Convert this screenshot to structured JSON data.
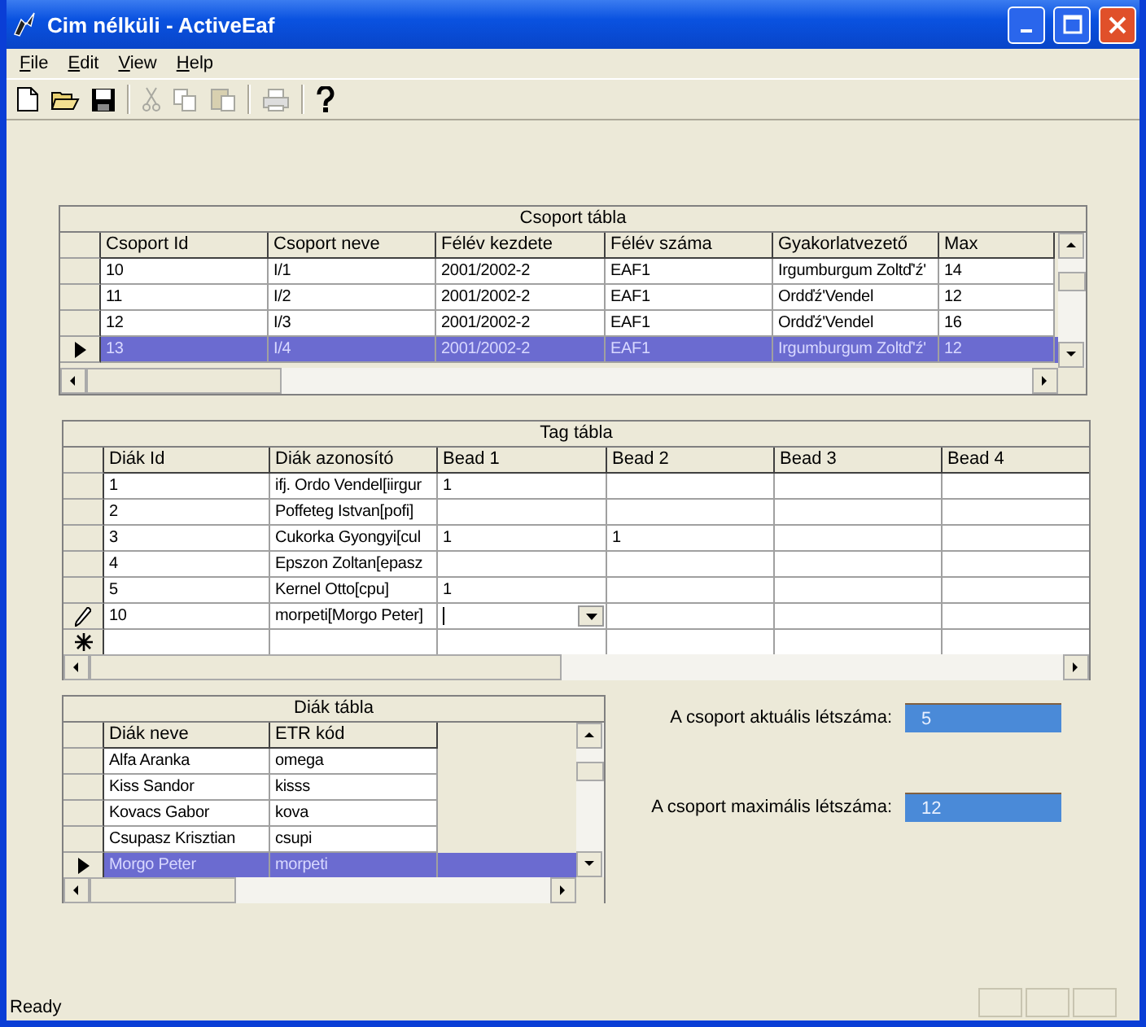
{
  "window": {
    "title": "Cim nélküli - ActiveEaf"
  },
  "menu": [
    {
      "label": "File"
    },
    {
      "label": "Edit"
    },
    {
      "label": "View"
    },
    {
      "label": "Help"
    }
  ],
  "toolbar": [
    {
      "kind": "new",
      "disabled": false
    },
    {
      "kind": "open",
      "disabled": false
    },
    {
      "kind": "save",
      "disabled": false
    },
    {
      "kind": "sep"
    },
    {
      "kind": "cut",
      "disabled": true
    },
    {
      "kind": "copy",
      "disabled": true
    },
    {
      "kind": "paste",
      "disabled": true
    },
    {
      "kind": "sep"
    },
    {
      "kind": "print",
      "disabled": true
    },
    {
      "kind": "sep"
    },
    {
      "kind": "help",
      "disabled": false
    }
  ],
  "csoport_table": {
    "caption": "Csoport tábla",
    "columns": [
      "Csoport Id",
      "Csoport neve",
      "Félév kezdete",
      "Félév száma",
      "Gyakorlatvezető",
      "Max"
    ],
    "rows": [
      {
        "cells": [
          "10",
          "I/1",
          "2001/2002-2",
          "EAF1",
          "Irgumburgum Zoltď'ź'",
          "14"
        ],
        "selected": false
      },
      {
        "cells": [
          "11",
          "I/2",
          "2001/2002-2",
          "EAF1",
          "Ordďź'Vendel",
          "12"
        ],
        "selected": false
      },
      {
        "cells": [
          "12",
          "I/3",
          "2001/2002-2",
          "EAF1",
          "Ordďź'Vendel",
          "16"
        ],
        "selected": false
      },
      {
        "cells": [
          "13",
          "I/4",
          "2001/2002-2",
          "EAF1",
          "Irgumburgum Zoltď'ź'",
          "12"
        ],
        "selected": true
      }
    ]
  },
  "tag_table": {
    "caption": "Tag tábla",
    "columns": [
      "Diák Id",
      "Diák azonosító",
      "Bead 1",
      "Bead 2",
      "Bead 3",
      "Bead 4"
    ],
    "rows": [
      {
        "kind": "normal",
        "cells": [
          "1",
          "ifj. Ordo Vendel[iirgur",
          "1",
          "",
          "",
          ""
        ]
      },
      {
        "kind": "normal",
        "cells": [
          "2",
          "Poffeteg Istvan[pofi]",
          "",
          "",
          "",
          ""
        ]
      },
      {
        "kind": "normal",
        "cells": [
          "3",
          "Cukorka Gyongyi[cul",
          "1",
          "1",
          "",
          ""
        ]
      },
      {
        "kind": "normal",
        "cells": [
          "4",
          "Epszon Zoltan[epasz",
          "",
          "",
          "",
          ""
        ]
      },
      {
        "kind": "normal",
        "cells": [
          "5",
          "Kernel Otto[cpu]",
          "1",
          "",
          "",
          ""
        ]
      },
      {
        "kind": "editing",
        "cells": [
          "10",
          "morpeti[Morgo Peter]",
          "",
          "",
          "",
          ""
        ]
      },
      {
        "kind": "new",
        "cells": [
          "",
          "",
          "",
          "",
          "",
          ""
        ]
      }
    ]
  },
  "diak_table": {
    "caption": "Diák tábla",
    "columns": [
      "Diák neve",
      "ETR kód"
    ],
    "rows": [
      {
        "cells": [
          "Alfa Aranka",
          "omega"
        ],
        "selected": false
      },
      {
        "cells": [
          "Kiss Sandor",
          "kisss"
        ],
        "selected": false
      },
      {
        "cells": [
          "Kovacs Gabor",
          "kova"
        ],
        "selected": false
      },
      {
        "cells": [
          "Csupasz Krisztian",
          "csupi"
        ],
        "selected": false
      },
      {
        "cells": [
          "Morgo Peter",
          "morpeti"
        ],
        "selected": true
      }
    ]
  },
  "stats": [
    {
      "label": "A csoport aktuális létszáma:",
      "value": "5"
    },
    {
      "label": "A csoport maximális létszáma:",
      "value": "12"
    }
  ],
  "status_bar": {
    "text": "Ready"
  }
}
